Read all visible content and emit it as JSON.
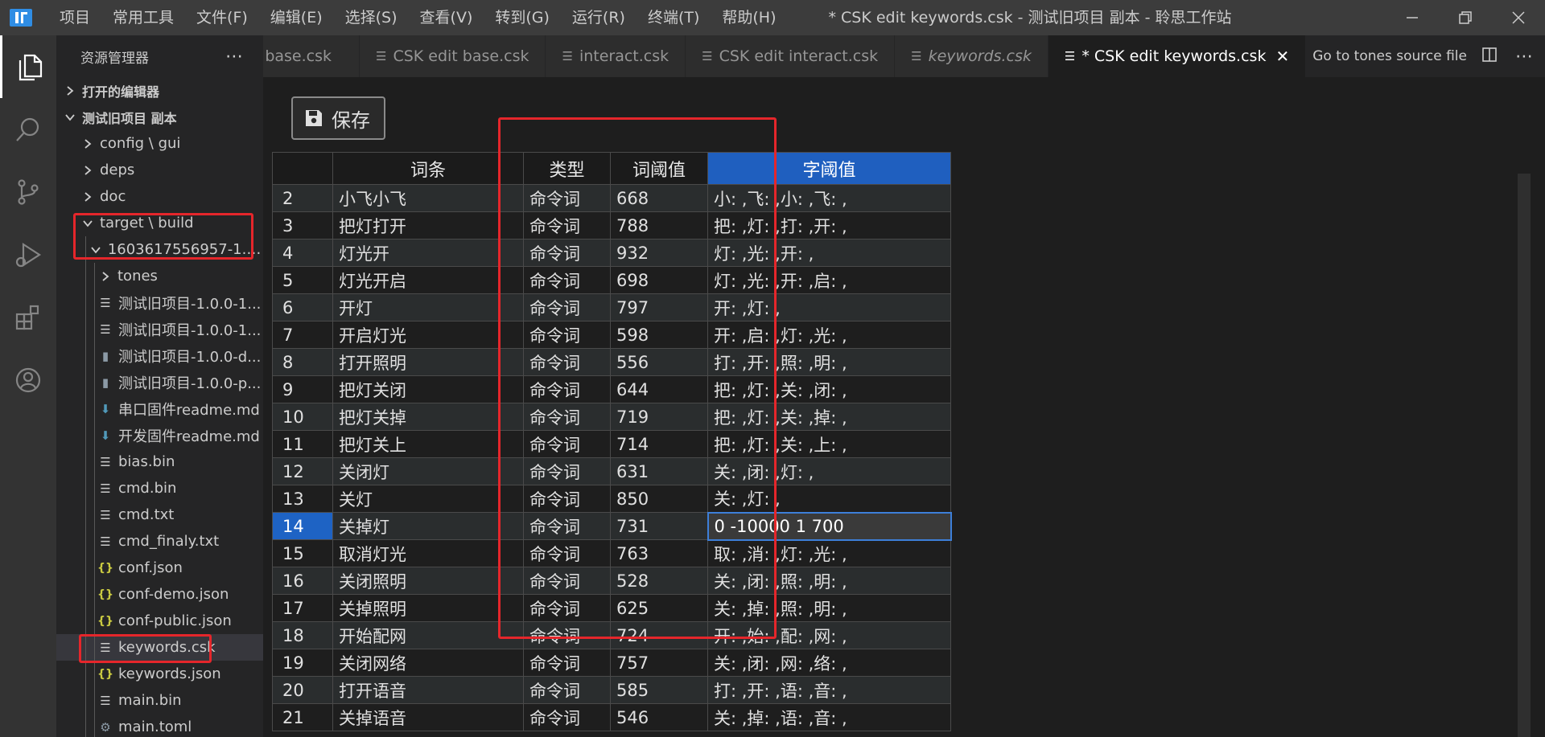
{
  "titlebar": {
    "menu": [
      "项目",
      "常用工具",
      "文件(F)",
      "编辑(E)",
      "选择(S)",
      "查看(V)",
      "转到(G)",
      "运行(R)",
      "终端(T)",
      "帮助(H)"
    ],
    "title": "* CSK edit keywords.csk - 测试旧项目 副本 - 聆思工作站"
  },
  "sidebar": {
    "header": "资源管理器",
    "open_editors": "打开的编辑器",
    "project": "测试旧项目 副本",
    "items": [
      {
        "label": "config \\ gui"
      },
      {
        "label": "deps"
      },
      {
        "label": "doc"
      },
      {
        "label": "target \\ build"
      },
      {
        "label": "1603617556957-1.0...."
      },
      {
        "label": "tones"
      },
      {
        "label": "测试旧项目-1.0.0-1..."
      },
      {
        "label": "测试旧项目-1.0.0-1..."
      },
      {
        "label": "测试旧项目-1.0.0-d..."
      },
      {
        "label": "测试旧项目-1.0.0-p..."
      },
      {
        "label": "串口固件readme.md"
      },
      {
        "label": "开发固件readme.md"
      },
      {
        "label": "bias.bin"
      },
      {
        "label": "cmd.bin"
      },
      {
        "label": "cmd.txt"
      },
      {
        "label": "cmd_finaly.txt"
      },
      {
        "label": "conf.json"
      },
      {
        "label": "conf-demo.json"
      },
      {
        "label": "conf-public.json"
      },
      {
        "label": "keywords.csk"
      },
      {
        "label": "keywords.json"
      },
      {
        "label": "main.bin"
      },
      {
        "label": "main.toml"
      }
    ]
  },
  "tabs": [
    {
      "label": "base.csk"
    },
    {
      "label": "CSK edit base.csk"
    },
    {
      "label": "interact.csk"
    },
    {
      "label": "CSK edit interact.csk"
    },
    {
      "label": "keywords.csk"
    },
    {
      "label": "* CSK edit keywords.csk"
    }
  ],
  "tab_actions": {
    "goto_tones": "Go to tones source file"
  },
  "editor": {
    "save_label": "保存",
    "columns": [
      "",
      "词条",
      "类型",
      "词阈值",
      "字阈值"
    ],
    "editing_value": "0 -10000 1 700",
    "rows": [
      [
        "2",
        "小飞小飞",
        "命令词",
        "668",
        "小: ,飞: ,小: ,飞: ,"
      ],
      [
        "3",
        "把灯打开",
        "命令词",
        "788",
        "把: ,灯: ,打: ,开: ,"
      ],
      [
        "4",
        "灯光开",
        "命令词",
        "932",
        "灯: ,光: ,开: ,"
      ],
      [
        "5",
        "灯光开启",
        "命令词",
        "698",
        "灯: ,光: ,开: ,启: ,"
      ],
      [
        "6",
        "开灯",
        "命令词",
        "797",
        "开: ,灯: ,"
      ],
      [
        "7",
        "开启灯光",
        "命令词",
        "598",
        "开: ,启: ,灯: ,光: ,"
      ],
      [
        "8",
        "打开照明",
        "命令词",
        "556",
        "打: ,开: ,照: ,明: ,"
      ],
      [
        "9",
        "把灯关闭",
        "命令词",
        "644",
        "把: ,灯: ,关: ,闭: ,"
      ],
      [
        "10",
        "把灯关掉",
        "命令词",
        "719",
        "把: ,灯: ,关: ,掉: ,"
      ],
      [
        "11",
        "把灯关上",
        "命令词",
        "714",
        "把: ,灯: ,关: ,上: ,"
      ],
      [
        "12",
        "关闭灯",
        "命令词",
        "631",
        "关: ,闭: ,灯: ,"
      ],
      [
        "13",
        "关灯",
        "命令词",
        "850",
        "关: ,灯: ,"
      ],
      [
        "14",
        "关掉灯",
        "命令词",
        "731",
        "0 -10000 1 700"
      ],
      [
        "15",
        "取消灯光",
        "命令词",
        "763",
        "取: ,消: ,灯: ,光: ,"
      ],
      [
        "16",
        "关闭照明",
        "命令词",
        "528",
        "关: ,闭: ,照: ,明: ,"
      ],
      [
        "17",
        "关掉照明",
        "命令词",
        "625",
        "关: ,掉: ,照: ,明: ,"
      ],
      [
        "18",
        "开始配网",
        "命令词",
        "724",
        "开: ,始: ,配: ,网: ,"
      ],
      [
        "19",
        "关闭网络",
        "命令词",
        "757",
        "关: ,闭: ,网: ,络: ,"
      ],
      [
        "20",
        "打开语音",
        "命令词",
        "585",
        "打: ,开: ,语: ,音: ,"
      ],
      [
        "21",
        "关掉语音",
        "命令词",
        "546",
        "关: ,掉: ,语: ,音: ,"
      ]
    ]
  }
}
